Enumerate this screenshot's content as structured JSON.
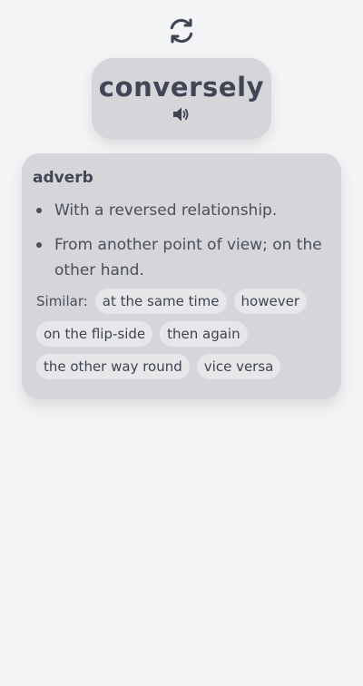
{
  "header": {
    "refresh_icon": "refresh-icon"
  },
  "word_card": {
    "word": "conversely",
    "speaker_icon": "speaker-icon"
  },
  "definition": {
    "part_of_speech": "adverb",
    "meanings": [
      "With a reversed relationship.",
      "From another point of view; on the other hand."
    ],
    "similar_label": "Similar:",
    "similar": [
      "at the same time",
      "however",
      "on the flip-side",
      "then again",
      "the other way round",
      "vice versa"
    ]
  },
  "colors": {
    "background": "#f3f4f6",
    "card": "#d5d5da",
    "chip": "#e7e7ea",
    "text": "#3f4452"
  }
}
